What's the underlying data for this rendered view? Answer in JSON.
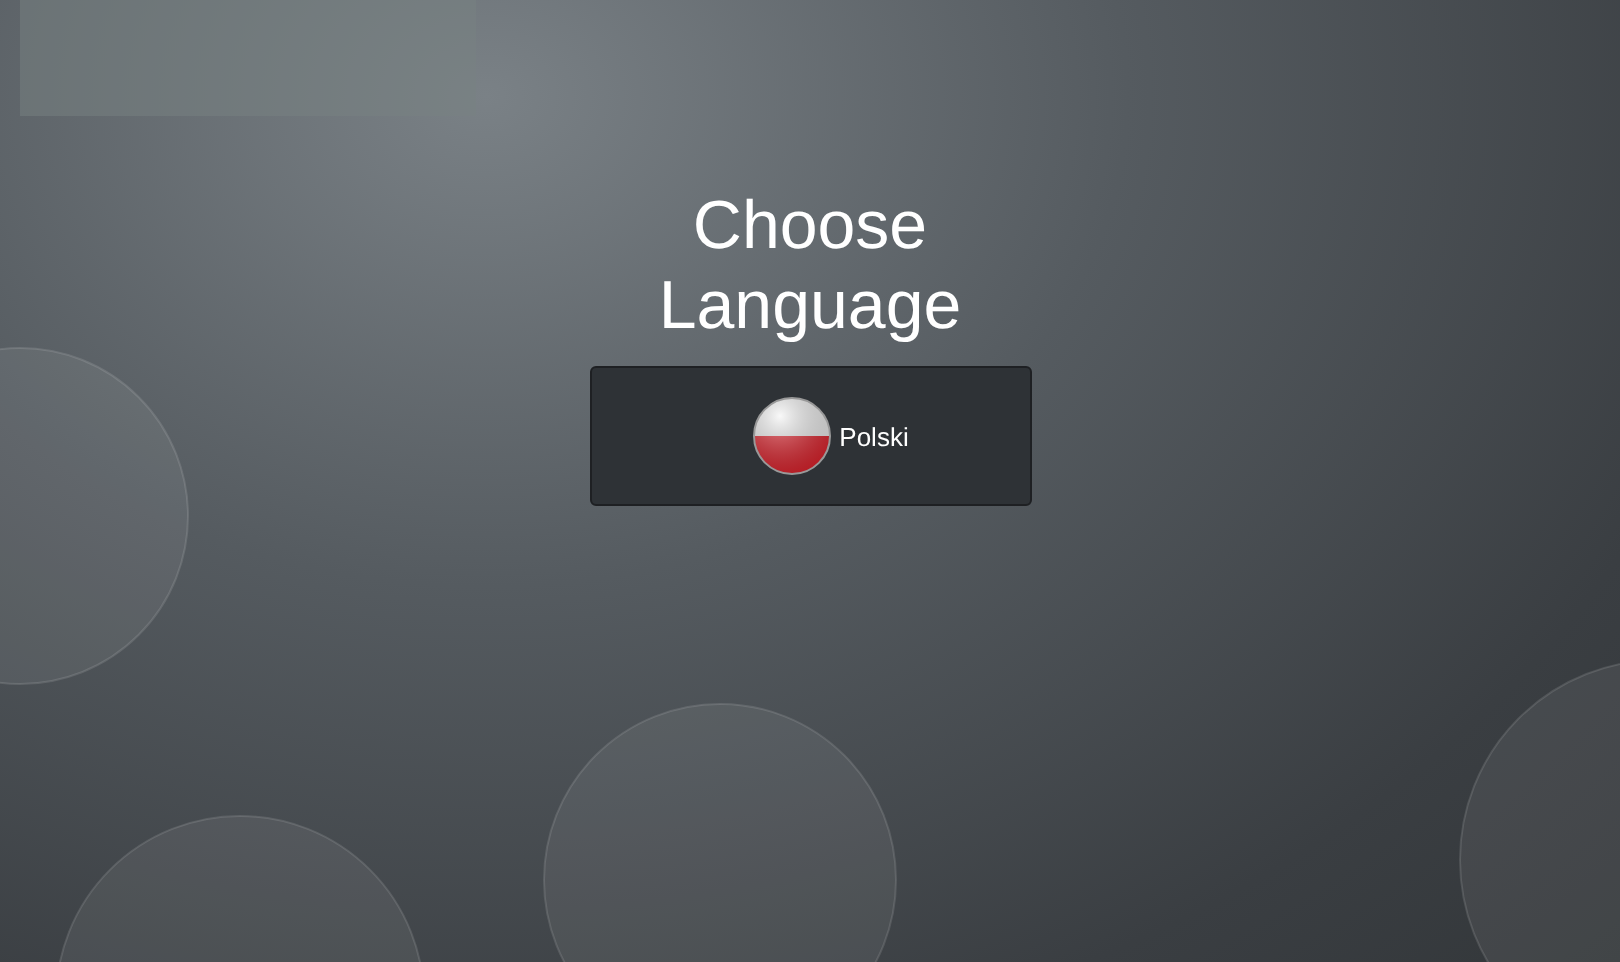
{
  "title": "Choose Language",
  "languages": [
    {
      "label": "Polski"
    }
  ]
}
